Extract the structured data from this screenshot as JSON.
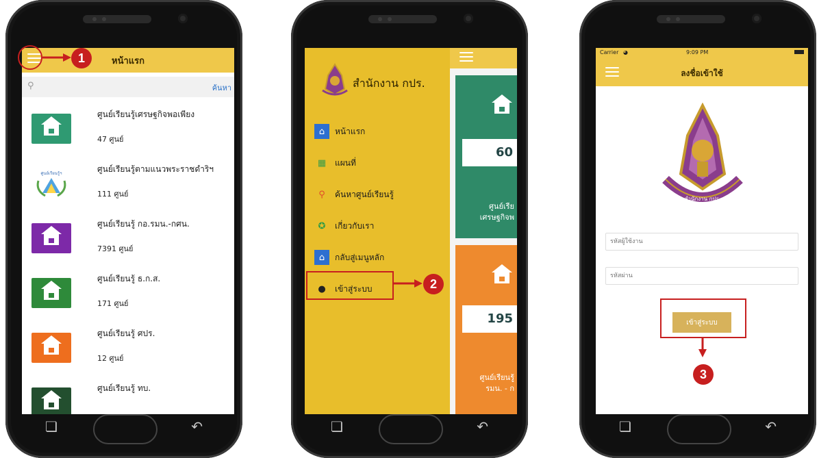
{
  "screen1": {
    "title": "หน้าแรก",
    "search_button": "ค้นหา",
    "items": [
      {
        "name": "ศูนย์เรียนรู้เศรษฐกิจพอเพียง",
        "count": "47 ศูนย์",
        "color": "#2f9a72",
        "icon": "house-icon"
      },
      {
        "name": "ศูนย์เรียนรู้ตามแนวพระราชดำริฯ",
        "count": "111 ศูนย์",
        "color": "#ffffff",
        "icon": "royal-project-logo",
        "logo_text": "ศูนย์เรียนรู้ฯ"
      },
      {
        "name": "ศูนย์เรียนรู้ กอ.รมน.-กศน.",
        "count": "7391 ศูนย์",
        "color": "#7d29a8",
        "icon": "house-icon"
      },
      {
        "name": "ศูนย์เรียนรู้ ธ.ก.ส.",
        "count": "171 ศูนย์",
        "color": "#2e8a3a",
        "icon": "house-icon"
      },
      {
        "name": "ศูนย์เรียนรู้ ศปร.",
        "count": "12 ศูนย์",
        "color": "#ee6e1e",
        "icon": "house-icon"
      },
      {
        "name": "ศูนย์เรียนรู้ ทบ.",
        "count": "",
        "color": "#234f2f",
        "icon": "house-icon"
      }
    ],
    "step": "1"
  },
  "screen2": {
    "org_name": "สำนักงาน กปร.",
    "menu": [
      {
        "label": "หน้าแรก",
        "icon": "home-icon"
      },
      {
        "label": "แผนที่",
        "icon": "map-icon"
      },
      {
        "label": "ค้นหาศูนย์เรียนรู้",
        "icon": "search-icon"
      },
      {
        "label": "เกี่ยวกับเรา",
        "icon": "info-icon"
      },
      {
        "label": "กลับสู่เมนูหลัก",
        "icon": "home-icon"
      },
      {
        "label": "เข้าสู่ระบบ",
        "icon": "user-icon"
      }
    ],
    "tiles": [
      {
        "value": "60",
        "caption_1": "ศูนย์เรีย",
        "caption_2": "เศรษฐกิจพ",
        "color": "#2f8a68"
      },
      {
        "value": "195",
        "caption_1": "ศูนย์เรียนรู้",
        "caption_2": "รมน. - ก",
        "color": "#ee8a2e"
      }
    ],
    "step": "2"
  },
  "screen3": {
    "carrier": "Carrier",
    "time": "9:09 PM",
    "title": "ลงชื่อเข้าใช้",
    "logo_caption": "สำนักงาน กปร.",
    "username_placeholder": "รหัสผู้ใช้งาน",
    "password_placeholder": "รหัสผ่าน",
    "login_button": "เข้าสู่ระบบ",
    "step": "3"
  },
  "colors": {
    "appbar": "#efc84a",
    "drawer": "#e8be2b",
    "highlight": "#c71f1f",
    "login_button": "#d7b25b"
  }
}
